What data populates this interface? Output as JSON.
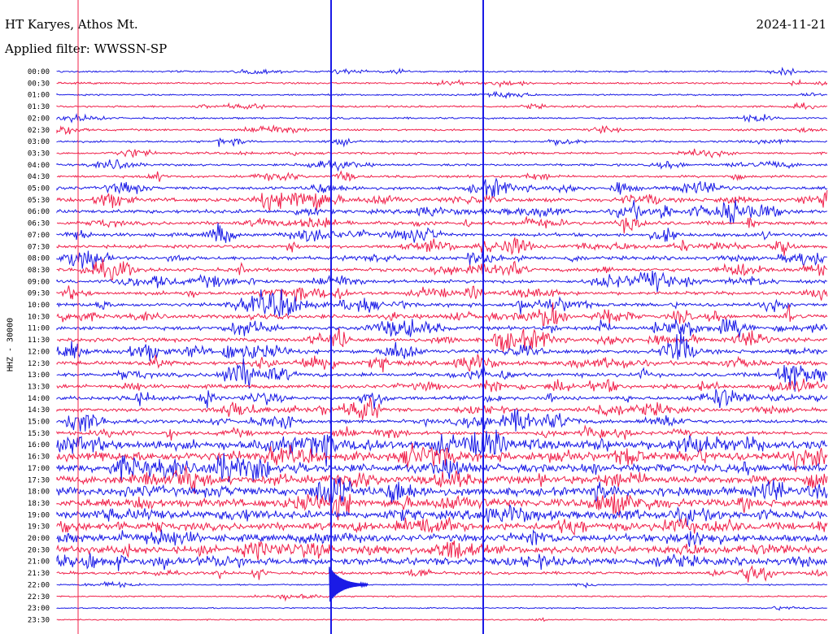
{
  "header": {
    "station": "HT Karyes, Athos Mt.",
    "filter": "Applied filter: WWSSN-SP",
    "date": "2024-11-21"
  },
  "channel_label": "HHZ - 30000",
  "colors": {
    "trace_a": "#1a1ae6",
    "trace_b": "#f0204a",
    "marker": "#1a1ae6",
    "marker_red": "#f0204a",
    "text": "#000000"
  },
  "chart_data": {
    "type": "line",
    "title": "",
    "subtitle": "",
    "xlabel": "",
    "ylabel": "HHZ - 30000",
    "grid": false,
    "legend": "none",
    "rows": [
      "00:00",
      "00:30",
      "01:00",
      "01:30",
      "02:00",
      "02:30",
      "03:00",
      "03:30",
      "04:00",
      "04:30",
      "05:00",
      "05:30",
      "06:00",
      "06:30",
      "07:00",
      "07:30",
      "08:00",
      "08:30",
      "09:00",
      "09:30",
      "10:00",
      "10:30",
      "11:00",
      "11:30",
      "12:00",
      "12:30",
      "13:00",
      "13:30",
      "14:00",
      "14:30",
      "15:00",
      "15:30",
      "16:00",
      "16:30",
      "17:00",
      "17:30",
      "18:00",
      "18:30",
      "19:00",
      "19:30",
      "20:00",
      "20:30",
      "21:00",
      "21:30",
      "22:00",
      "22:30",
      "23:00",
      "23:30"
    ],
    "row_color_order": [
      "trace_a",
      "trace_b"
    ],
    "row_activity": [
      0.25,
      0.28,
      0.2,
      0.32,
      0.3,
      0.35,
      0.33,
      0.38,
      0.4,
      0.45,
      0.7,
      0.95,
      0.9,
      0.85,
      0.8,
      0.75,
      0.85,
      0.8,
      0.75,
      0.8,
      0.9,
      0.95,
      0.9,
      0.95,
      1.0,
      0.95,
      0.95,
      0.9,
      0.85,
      0.8,
      0.85,
      0.8,
      1.0,
      1.0,
      0.9,
      0.85,
      0.9,
      0.9,
      0.85,
      0.8,
      0.75,
      0.8,
      0.8,
      0.6,
      0.12,
      0.12,
      0.1,
      0.08
    ],
    "event_rows": [
      "21:30",
      "22:00",
      "22:30"
    ]
  }
}
